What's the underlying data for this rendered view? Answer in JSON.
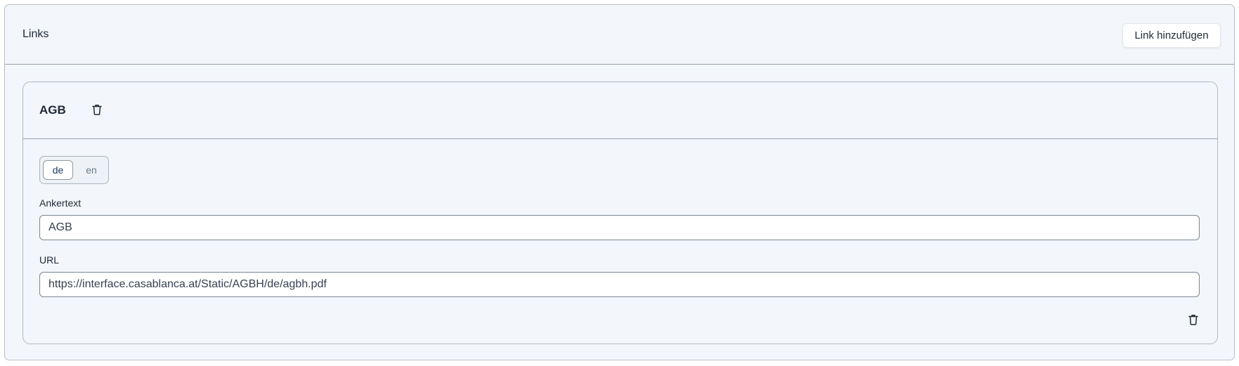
{
  "panel": {
    "title": "Links",
    "add_button_label": "Link hinzufügen"
  },
  "link_card": {
    "title": "AGB",
    "languages": [
      {
        "code": "de",
        "active": true
      },
      {
        "code": "en",
        "active": false
      }
    ],
    "anchor_label": "Ankertext",
    "anchor_value": "AGB",
    "url_label": "URL",
    "url_value": "https://interface.casablanca.at/Static/AGBH/de/agbh.pdf",
    "title_icon": "trash-icon",
    "delete_icon": "trash-icon"
  },
  "colors": {
    "panel_bg": "#f3f6fa",
    "border": "#9aa3ad",
    "active_lang_text": "#1e3a5f",
    "inactive_lang_text": "#6b7a8a"
  }
}
